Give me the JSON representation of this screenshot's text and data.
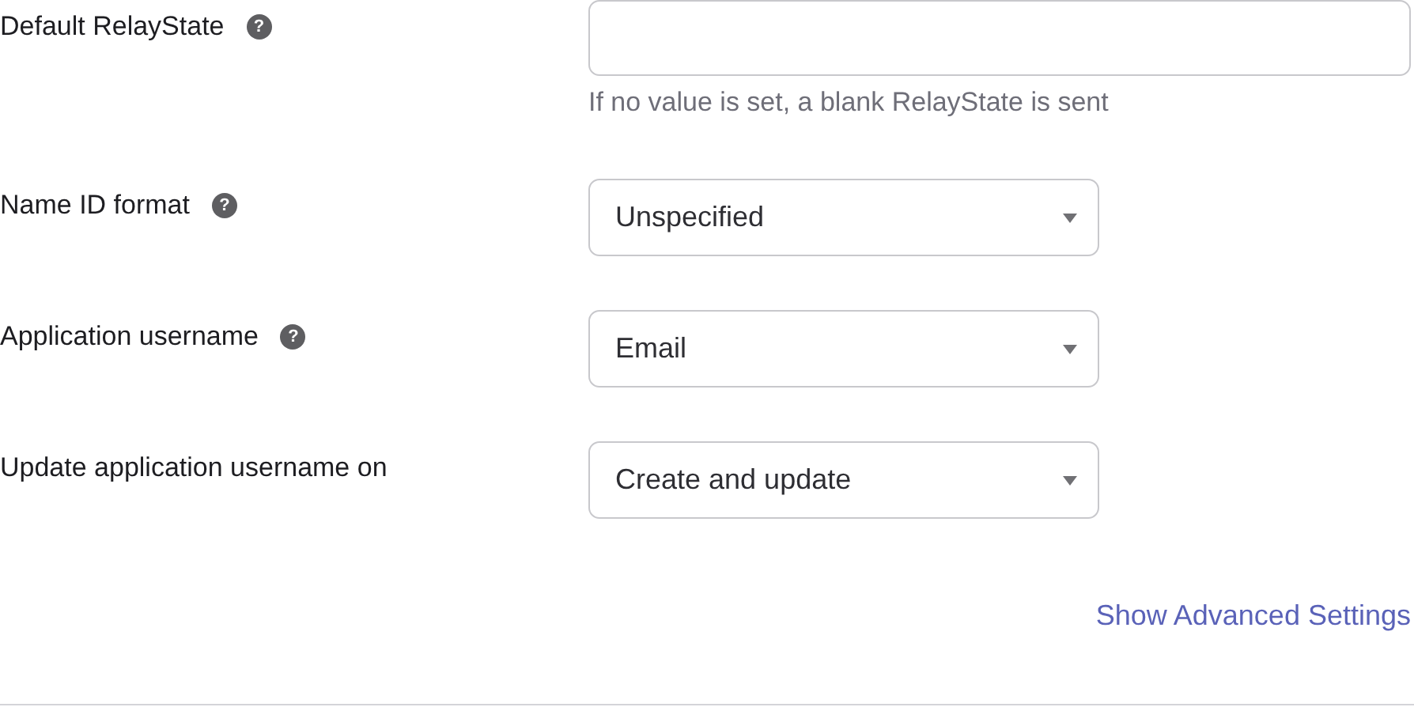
{
  "fields": [
    {
      "label": "Default RelayState",
      "help": "?",
      "kind": "text",
      "hint": "If no value is set, a blank RelayState is sent"
    },
    {
      "label": "Name ID format",
      "help": "?",
      "kind": "select",
      "value": "Unspecified"
    },
    {
      "label": "Application username",
      "help": "?",
      "kind": "select",
      "value": "Email"
    },
    {
      "label": "Update application username on",
      "kind": "select",
      "value": "Create and update"
    }
  ],
  "advanced_link": "Show Advanced Settings"
}
